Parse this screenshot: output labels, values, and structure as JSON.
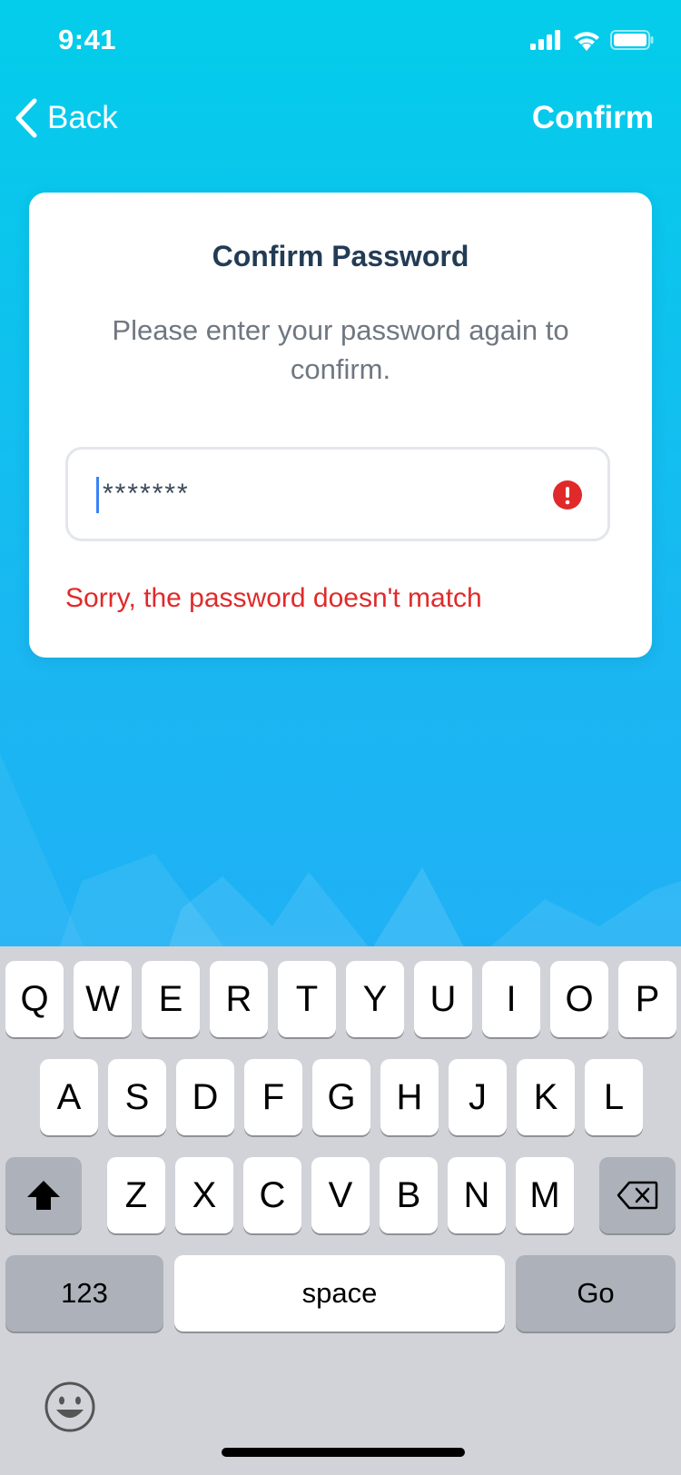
{
  "status_bar": {
    "time": "9:41",
    "icons": [
      "cellular-signal-icon",
      "wifi-icon",
      "battery-icon"
    ]
  },
  "nav": {
    "back_label": "Back",
    "confirm_label": "Confirm"
  },
  "card": {
    "title": "Confirm Password",
    "subtitle": "Please enter your password again to confirm.",
    "password_value": "*******",
    "error_message": "Sorry, the password doesn't match"
  },
  "keyboard": {
    "row1": [
      "Q",
      "W",
      "E",
      "R",
      "T",
      "Y",
      "U",
      "I",
      "O",
      "P"
    ],
    "row2": [
      "A",
      "S",
      "D",
      "F",
      "G",
      "H",
      "J",
      "K",
      "L"
    ],
    "row3": [
      "Z",
      "X",
      "C",
      "V",
      "B",
      "N",
      "M"
    ],
    "numbers_label": "123",
    "space_label": "space",
    "go_label": "Go"
  },
  "colors": {
    "error": "#e02a2a",
    "title": "#233c55",
    "accent_caret": "#3b82f6"
  }
}
